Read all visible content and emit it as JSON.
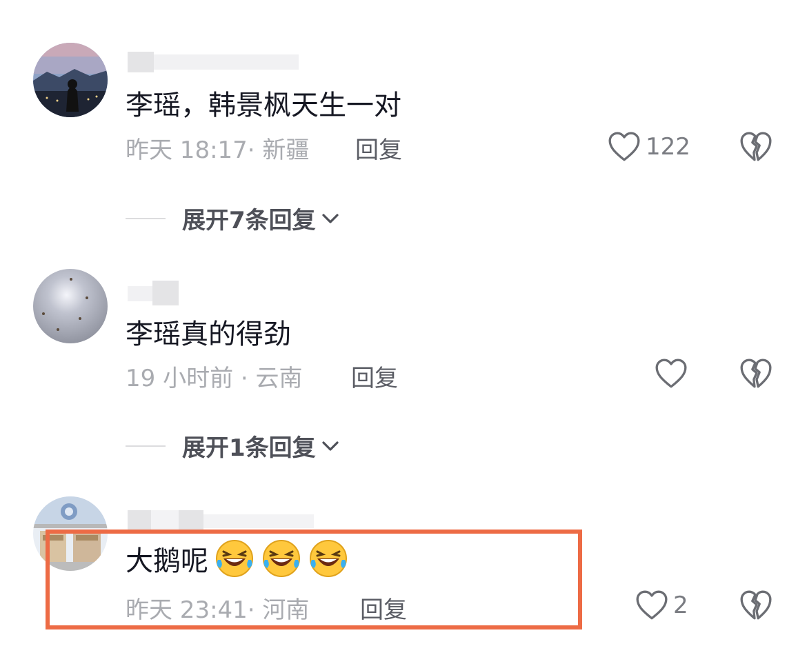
{
  "comments": [
    {
      "text": "李瑶，韩景枫天生一对",
      "time": "昨天 18:17·",
      "location": "新疆",
      "reply": "回复",
      "likes": "122",
      "expand": "展开7条回复"
    },
    {
      "text": "李瑶真的得劲",
      "time": "19 小时前 ·",
      "location": "云南",
      "reply": "回复",
      "likes": "",
      "expand": "展开1条回复"
    },
    {
      "text": "大鹅呢",
      "time": "昨天 23:41·",
      "location": "河南",
      "reply": "回复",
      "likes": "2",
      "emojis": [
        "rolling-laughing-emoji",
        "rolling-laughing-emoji",
        "rolling-laughing-emoji"
      ]
    }
  ],
  "colors": {
    "highlight_border": "#ed6b45",
    "text_primary": "#161823",
    "text_secondary": "#a9abb0"
  }
}
